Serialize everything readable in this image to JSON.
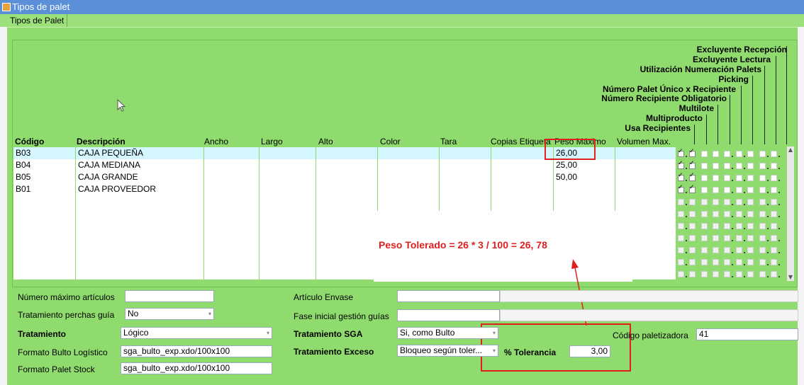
{
  "window": {
    "title": "Tipos de palet",
    "tab": "Tipos de Palet"
  },
  "vertical_headers": [
    "Excluyente Recepción",
    "Excluyente Lectura",
    "Utilización Numeración Palets",
    "Picking",
    "Número Palet Único x Recipiente",
    "Número Recipiente Obligatorio",
    "Multilote",
    "Multiproducto",
    "Usa Recipientes"
  ],
  "columns": [
    "Código",
    "Descripción",
    "Ancho",
    "Largo",
    "Alto",
    "Color",
    "Tara",
    "Copias Etiqueta",
    "Peso Máximo",
    "Volumen Max."
  ],
  "rows": [
    {
      "codigo": "B03",
      "descripcion": "CAJA PEQUEÑA",
      "peso": "26,00"
    },
    {
      "codigo": "B04",
      "descripcion": "CAJA MEDIANA",
      "peso": "25,00"
    },
    {
      "codigo": "B05",
      "descripcion": "CAJA GRANDE",
      "peso": "50,00"
    },
    {
      "codigo": "B01",
      "descripcion": "CAJA PROVEEDOR",
      "peso": ""
    }
  ],
  "annotation": "Peso Tolerado = 26 * 3 / 100 =  26, 78",
  "form": {
    "num_max_articulos_label": "Número máximo artículos",
    "num_max_articulos_value": "",
    "tratamiento_perchas_label": "Tratamiento perchas guía",
    "tratamiento_perchas_value": "No",
    "tratamiento_label": "Tratamiento",
    "tratamiento_value": "Lógico",
    "formato_bulto_label": "Formato Bulto Logístico",
    "formato_bulto_value": "sga_bulto_exp.xdo/100x100",
    "formato_palet_label": "Formato Palet Stock",
    "formato_palet_value": "sga_bulto_exp.xdo/100x100",
    "articulo_envase_label": "Artículo Envase",
    "articulo_envase_value": "",
    "fase_inicial_label": "Fase inicial gestión guías",
    "fase_inicial_value": "",
    "tratamiento_sga_label": "Tratamiento SGA",
    "tratamiento_sga_value": "Si, como Bulto",
    "tratamiento_exceso_label": "Tratamiento Exceso",
    "tratamiento_exceso_value": "Bloqueo según toler...",
    "tolerancia_label": "% Tolerancia",
    "tolerancia_value": "3,00",
    "codigo_paletizadora_label": "Código paletizadora",
    "codigo_paletizadora_value": "41"
  },
  "colors": {
    "panel": "#8fdb6e",
    "title": "#5b8fd8",
    "annotation": "#e02020",
    "selected_row": "#d4f6ff"
  }
}
